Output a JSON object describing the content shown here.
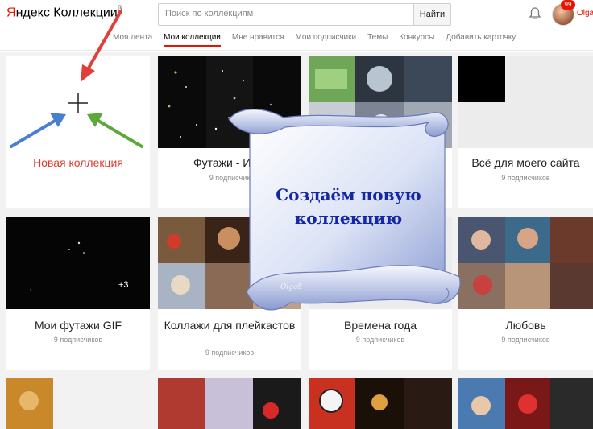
{
  "app": {
    "logo_brand": "Я",
    "logo_brand_rest": "ндекс",
    "logo_product": " Коллекции",
    "logo_beta": "β"
  },
  "search": {
    "placeholder": "Поиск по коллекциям",
    "value": "",
    "button_label": "Найти"
  },
  "user": {
    "name": "Olga",
    "badge_count": "99"
  },
  "nav": [
    {
      "label": "Моя лента",
      "active": false
    },
    {
      "label": "Мои коллекции",
      "active": true
    },
    {
      "label": "Мне нравится",
      "active": false
    },
    {
      "label": "Мои подписчики",
      "active": false
    },
    {
      "label": "Темы",
      "active": false
    },
    {
      "label": "Конкурсы",
      "active": false
    },
    {
      "label": "Добавить карточку",
      "active": false
    }
  ],
  "new_collection": {
    "label": "Новая коллекция"
  },
  "cards": [
    {
      "title": "Футажи - ИНТ",
      "subtitle": "9 подписчик"
    },
    {
      "title": "",
      "subtitle": ""
    },
    {
      "title": "Всё для моего сайта",
      "subtitle": "9 подписчиков"
    },
    {
      "title": "Мои футажи GIF",
      "subtitle": "9 подписчиков",
      "overlay": "+3"
    },
    {
      "title": "Коллажи для плейкастов",
      "subtitle": "9 подписчиков"
    },
    {
      "title": "Времена года",
      "subtitle": "9 подписчиков"
    },
    {
      "title": "Любовь",
      "subtitle": "9 подписчиков"
    }
  ],
  "scroll": {
    "line1": "Создаём новую",
    "line2": "коллекцию",
    "watermark": "Olga8"
  },
  "colors": {
    "accent": "#e61400",
    "scroll_text": "#1428a6",
    "arrow_red": "#e0403a",
    "arrow_blue": "#4a7fd0",
    "arrow_green": "#5ca83a"
  },
  "icons": [
    "bell-icon",
    "plus-icon",
    "avatar"
  ]
}
